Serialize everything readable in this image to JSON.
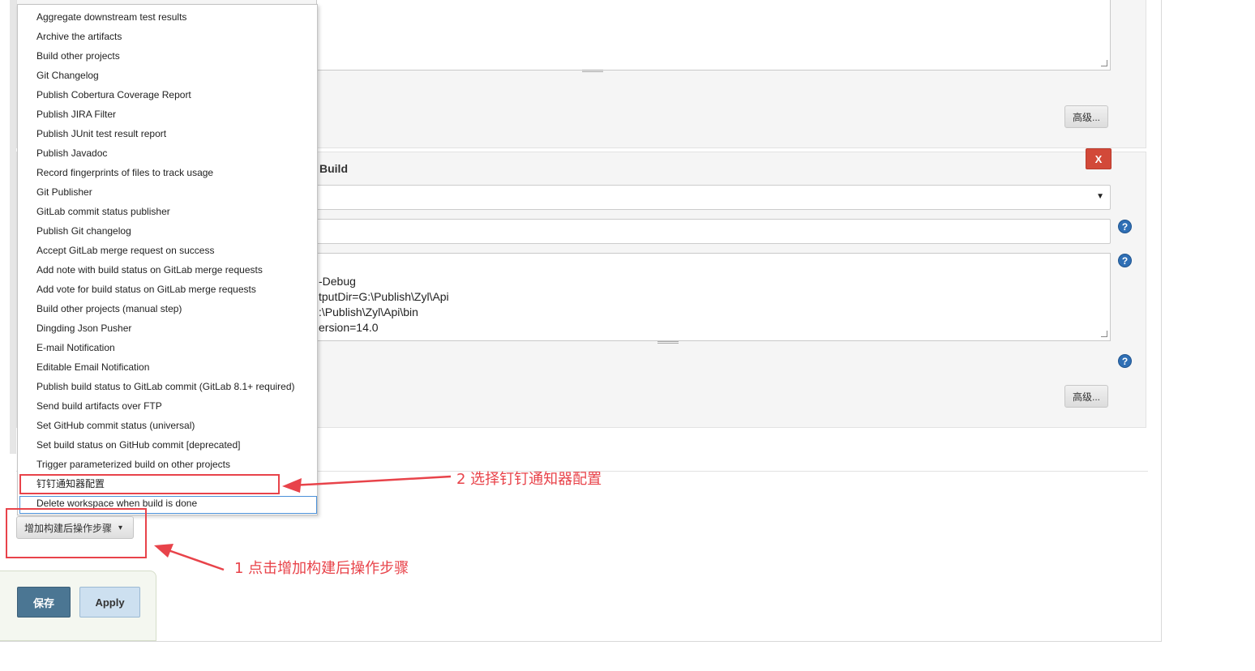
{
  "section_top": {
    "advanced_button": "高级..."
  },
  "msbuild": {
    "title_suffix": "Build",
    "delete_button": "X",
    "select_arrow": "▼",
    "args_lines": [
      "-Debug",
      "tputDir=G:\\Publish\\Zyl\\Api",
      ":\\Publish\\Zyl\\Api\\bin",
      "ersion=14.0"
    ],
    "help_icon": "?",
    "advanced_button": "高级..."
  },
  "dropdown_menu": {
    "items": [
      "Aggregate downstream test results",
      "Archive the artifacts",
      "Build other projects",
      "Git Changelog",
      "Publish Cobertura Coverage Report",
      "Publish JIRA Filter",
      "Publish JUnit test result report",
      "Publish Javadoc",
      "Record fingerprints of files to track usage",
      "Git Publisher",
      "GitLab commit status publisher",
      "Publish Git changelog",
      "Accept GitLab merge request on success",
      "Add note with build status on GitLab merge requests",
      "Add vote for build status on GitLab merge requests",
      "Build other projects (manual step)",
      "Dingding Json Pusher",
      "E-mail Notification",
      "Editable Email Notification",
      "Publish build status to GitLab commit (GitLab 8.1+ required)",
      "Send build artifacts over FTP",
      "Set GitHub commit status (universal)",
      "Set build status on GitHub commit [deprecated]",
      "Trigger parameterized build on other projects",
      "钉钉通知器配置",
      "Delete workspace when build is done"
    ]
  },
  "add_post_build_button": {
    "label": "增加构建后操作步骤",
    "arrow": "▾"
  },
  "annotations": {
    "step1": "1 点击增加构建后操作步骤",
    "step2": "2 选择钉钉通知器配置"
  },
  "footer": {
    "save": "保存",
    "apply": "Apply"
  },
  "colors": {
    "annotation_red": "#e8434a",
    "save_blue": "#4b7693",
    "apply_blue": "#cde0f0",
    "delete_red": "#d24939"
  }
}
